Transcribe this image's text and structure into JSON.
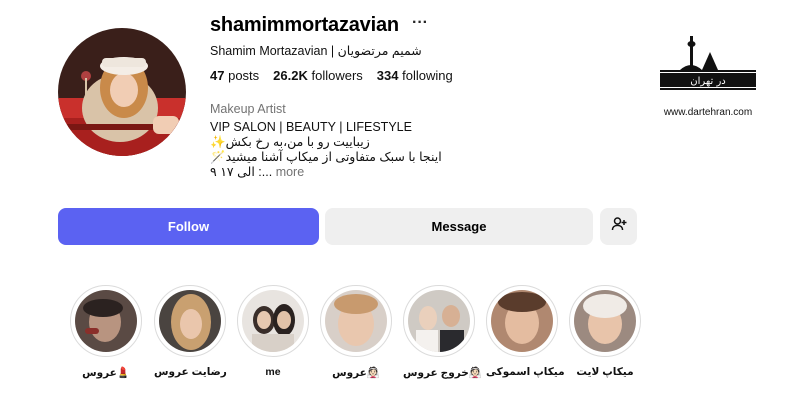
{
  "profile": {
    "username": "shamimmortazavian",
    "more_glyph": "···",
    "full_name": "Shamim Mortazavian | شمیم مرتضویان",
    "stats": [
      {
        "value": "47",
        "label": "posts"
      },
      {
        "value": "26.2K",
        "label": "followers"
      },
      {
        "value": "334",
        "label": "following"
      }
    ],
    "category": "Makeup Artist",
    "bio_lines": [
      "VIP SALON | BEAUTY | LIFESTYLE",
      "✨زیباییت رو با من،به رخ بکش",
      "🪄اینجا با سبک متفاوتی از میکاپ آشنا میشید",
      "الی ۱۷ ۹ :..."
    ],
    "bio_more": "more"
  },
  "actions": {
    "follow": "Follow",
    "message": "Message"
  },
  "highlights": [
    {
      "label": "عروس💄"
    },
    {
      "label": "رضایت عروس"
    },
    {
      "label": "me"
    },
    {
      "label": "عروس👰🏻"
    },
    {
      "label": "خروج عروس👰🏻"
    },
    {
      "label": "میکاپ اسموکی"
    },
    {
      "label": "میکاپ لایت"
    }
  ],
  "watermark": {
    "logo_text": "در تهران",
    "url": "www.dartehran.com"
  },
  "colors": {
    "follow_bg": "#5b62f2",
    "secondary_btn_bg": "#efefef",
    "muted_text": "#737373"
  }
}
